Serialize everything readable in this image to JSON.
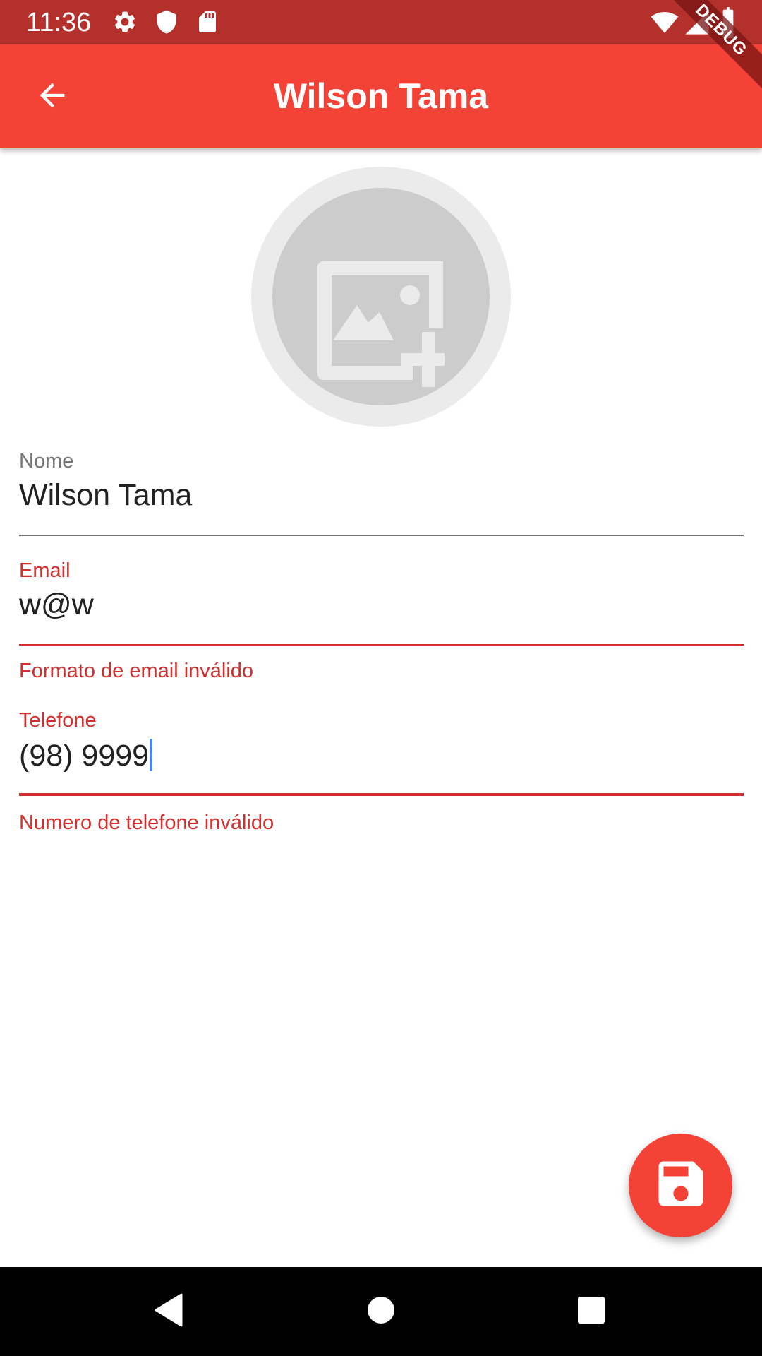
{
  "status_bar": {
    "time": "11:36",
    "icons": [
      "gear-icon",
      "shield-icon",
      "sd-card-icon",
      "wifi-icon",
      "signal-icon",
      "battery-icon"
    ]
  },
  "app_bar": {
    "title": "Wilson Tama",
    "back_icon": "arrow-back-icon",
    "color": "#f44336"
  },
  "debug_banner": {
    "label": "DEBUG"
  },
  "avatar": {
    "icon": "add-photo-icon"
  },
  "form": {
    "name": {
      "label": "Nome",
      "value": "Wilson Tama"
    },
    "email": {
      "label": "Email",
      "value": "w@w",
      "error": "Formato de email inválido"
    },
    "phone": {
      "label": "Telefone",
      "value": "(98) 9999",
      "error": "Numero de telefone inválido"
    }
  },
  "fab": {
    "icon": "save-icon",
    "color": "#f44336"
  },
  "colors": {
    "error": "#d32f2f",
    "status_bar": "#b3302b"
  },
  "nav_bar": {
    "icons": [
      "back-triangle-icon",
      "home-circle-icon",
      "recents-square-icon"
    ]
  }
}
